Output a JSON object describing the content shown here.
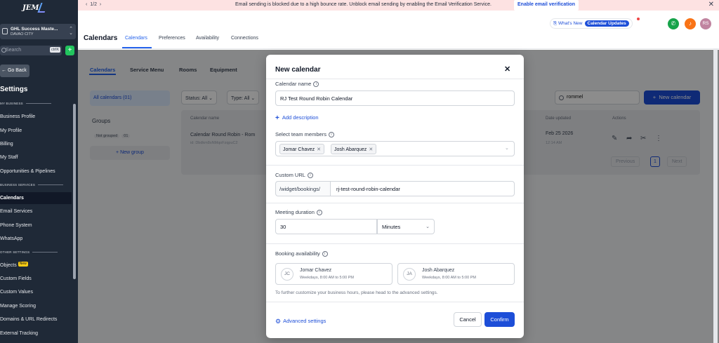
{
  "sidebar": {
    "logo": "JEM",
    "account_name": "GHL Success Maste...",
    "account_city": "DAVAO CITY",
    "search_placeholder": "Search",
    "search_shortcut": "ctrlK",
    "go_back": "Go Back",
    "settings_title": "Settings",
    "section_my_business": "MY BUSINESS",
    "section_business_services": "BUSINESS SERVICES",
    "section_other_settings": "OTHER SETTINGS",
    "items": [
      {
        "label": "Business Profile"
      },
      {
        "label": "My Profile"
      },
      {
        "label": "Billing"
      },
      {
        "label": "My Staff"
      },
      {
        "label": "Opportunities & Pipelines"
      },
      {
        "label": "Calendars"
      },
      {
        "label": "Email Services"
      },
      {
        "label": "Phone System"
      },
      {
        "label": "WhatsApp"
      },
      {
        "label": "Objects",
        "badge": "New"
      },
      {
        "label": "Custom Fields"
      },
      {
        "label": "Custom Values"
      },
      {
        "label": "Manage Scoring"
      },
      {
        "label": "Domains & URL Redirects"
      },
      {
        "label": "External Tracking"
      }
    ]
  },
  "banner": {
    "pager": "1/2",
    "message": "Email sending is blocked due to a high bounce rate. Unblock email sending by enabling the Email Verification Service.",
    "cta": "Enable email verification"
  },
  "header": {
    "title": "Calendars",
    "tabs": [
      "Calendars",
      "Preferences",
      "Availability",
      "Connections"
    ],
    "whats_new": "What's New",
    "calendar_updates": "Calendar Updates",
    "avatar_initials": "RS"
  },
  "page": {
    "subtabs": [
      "Calendars",
      "Service Menu",
      "Rooms",
      "Equipment"
    ],
    "all_calendars": "All calendars (01)",
    "groups_heading": "Groups",
    "not_grouped": "Not grouped",
    "not_grouped_count": "01",
    "new_group": "+ New group",
    "filter_status": "Status: All",
    "filter_type": "Type: All",
    "search_value": "rommel",
    "new_calendar": "New calendar",
    "col_name": "Calendar name",
    "col_date": "Date updated",
    "col_actions": "Actions",
    "row_name": "Calendar Round Robin - Rom",
    "row_id": "id: Dbdkm8sNMqoFzqpuC2",
    "row_date": "Feb 25 2026",
    "row_time": "12:14 AM",
    "pag_prev": "Previous",
    "pag_page": "1",
    "pag_next": "Next"
  },
  "modal": {
    "title": "New calendar",
    "name_label": "Calendar name",
    "name_value": "RJ Test Round Robin Calendar",
    "add_description": "Add description",
    "team_label": "Select team members",
    "team_members": [
      "Jomar Chavez",
      "Josh Abarquez"
    ],
    "url_label": "Custom URL",
    "url_prefix": "/widget/bookings/",
    "url_value": "rj-test-round-robin-calendar",
    "duration_label": "Meeting duration",
    "duration_value": "30",
    "duration_unit": "Minutes",
    "availability_label": "Booking availability",
    "availability": [
      {
        "initials": "JC",
        "name": "Jomar Chavez",
        "hours": "Weekdays, 8:00 AM to 5:00 PM"
      },
      {
        "initials": "JA",
        "name": "Josh Abarquez",
        "hours": "Weekdays, 8:00 AM to 5:00 PM"
      }
    ],
    "note": "To further customize your business hours, please head to the advanced settings.",
    "advanced_settings": "Advanced settings",
    "cancel": "Cancel",
    "confirm": "Confirm"
  },
  "colors": {
    "primary": "#1d4ed8",
    "sidebar_bg": "#1f2937",
    "banner_bg": "#fde2e2",
    "phone": "#16a34a",
    "bell": "#f97316",
    "avatar": "#c084a0"
  }
}
